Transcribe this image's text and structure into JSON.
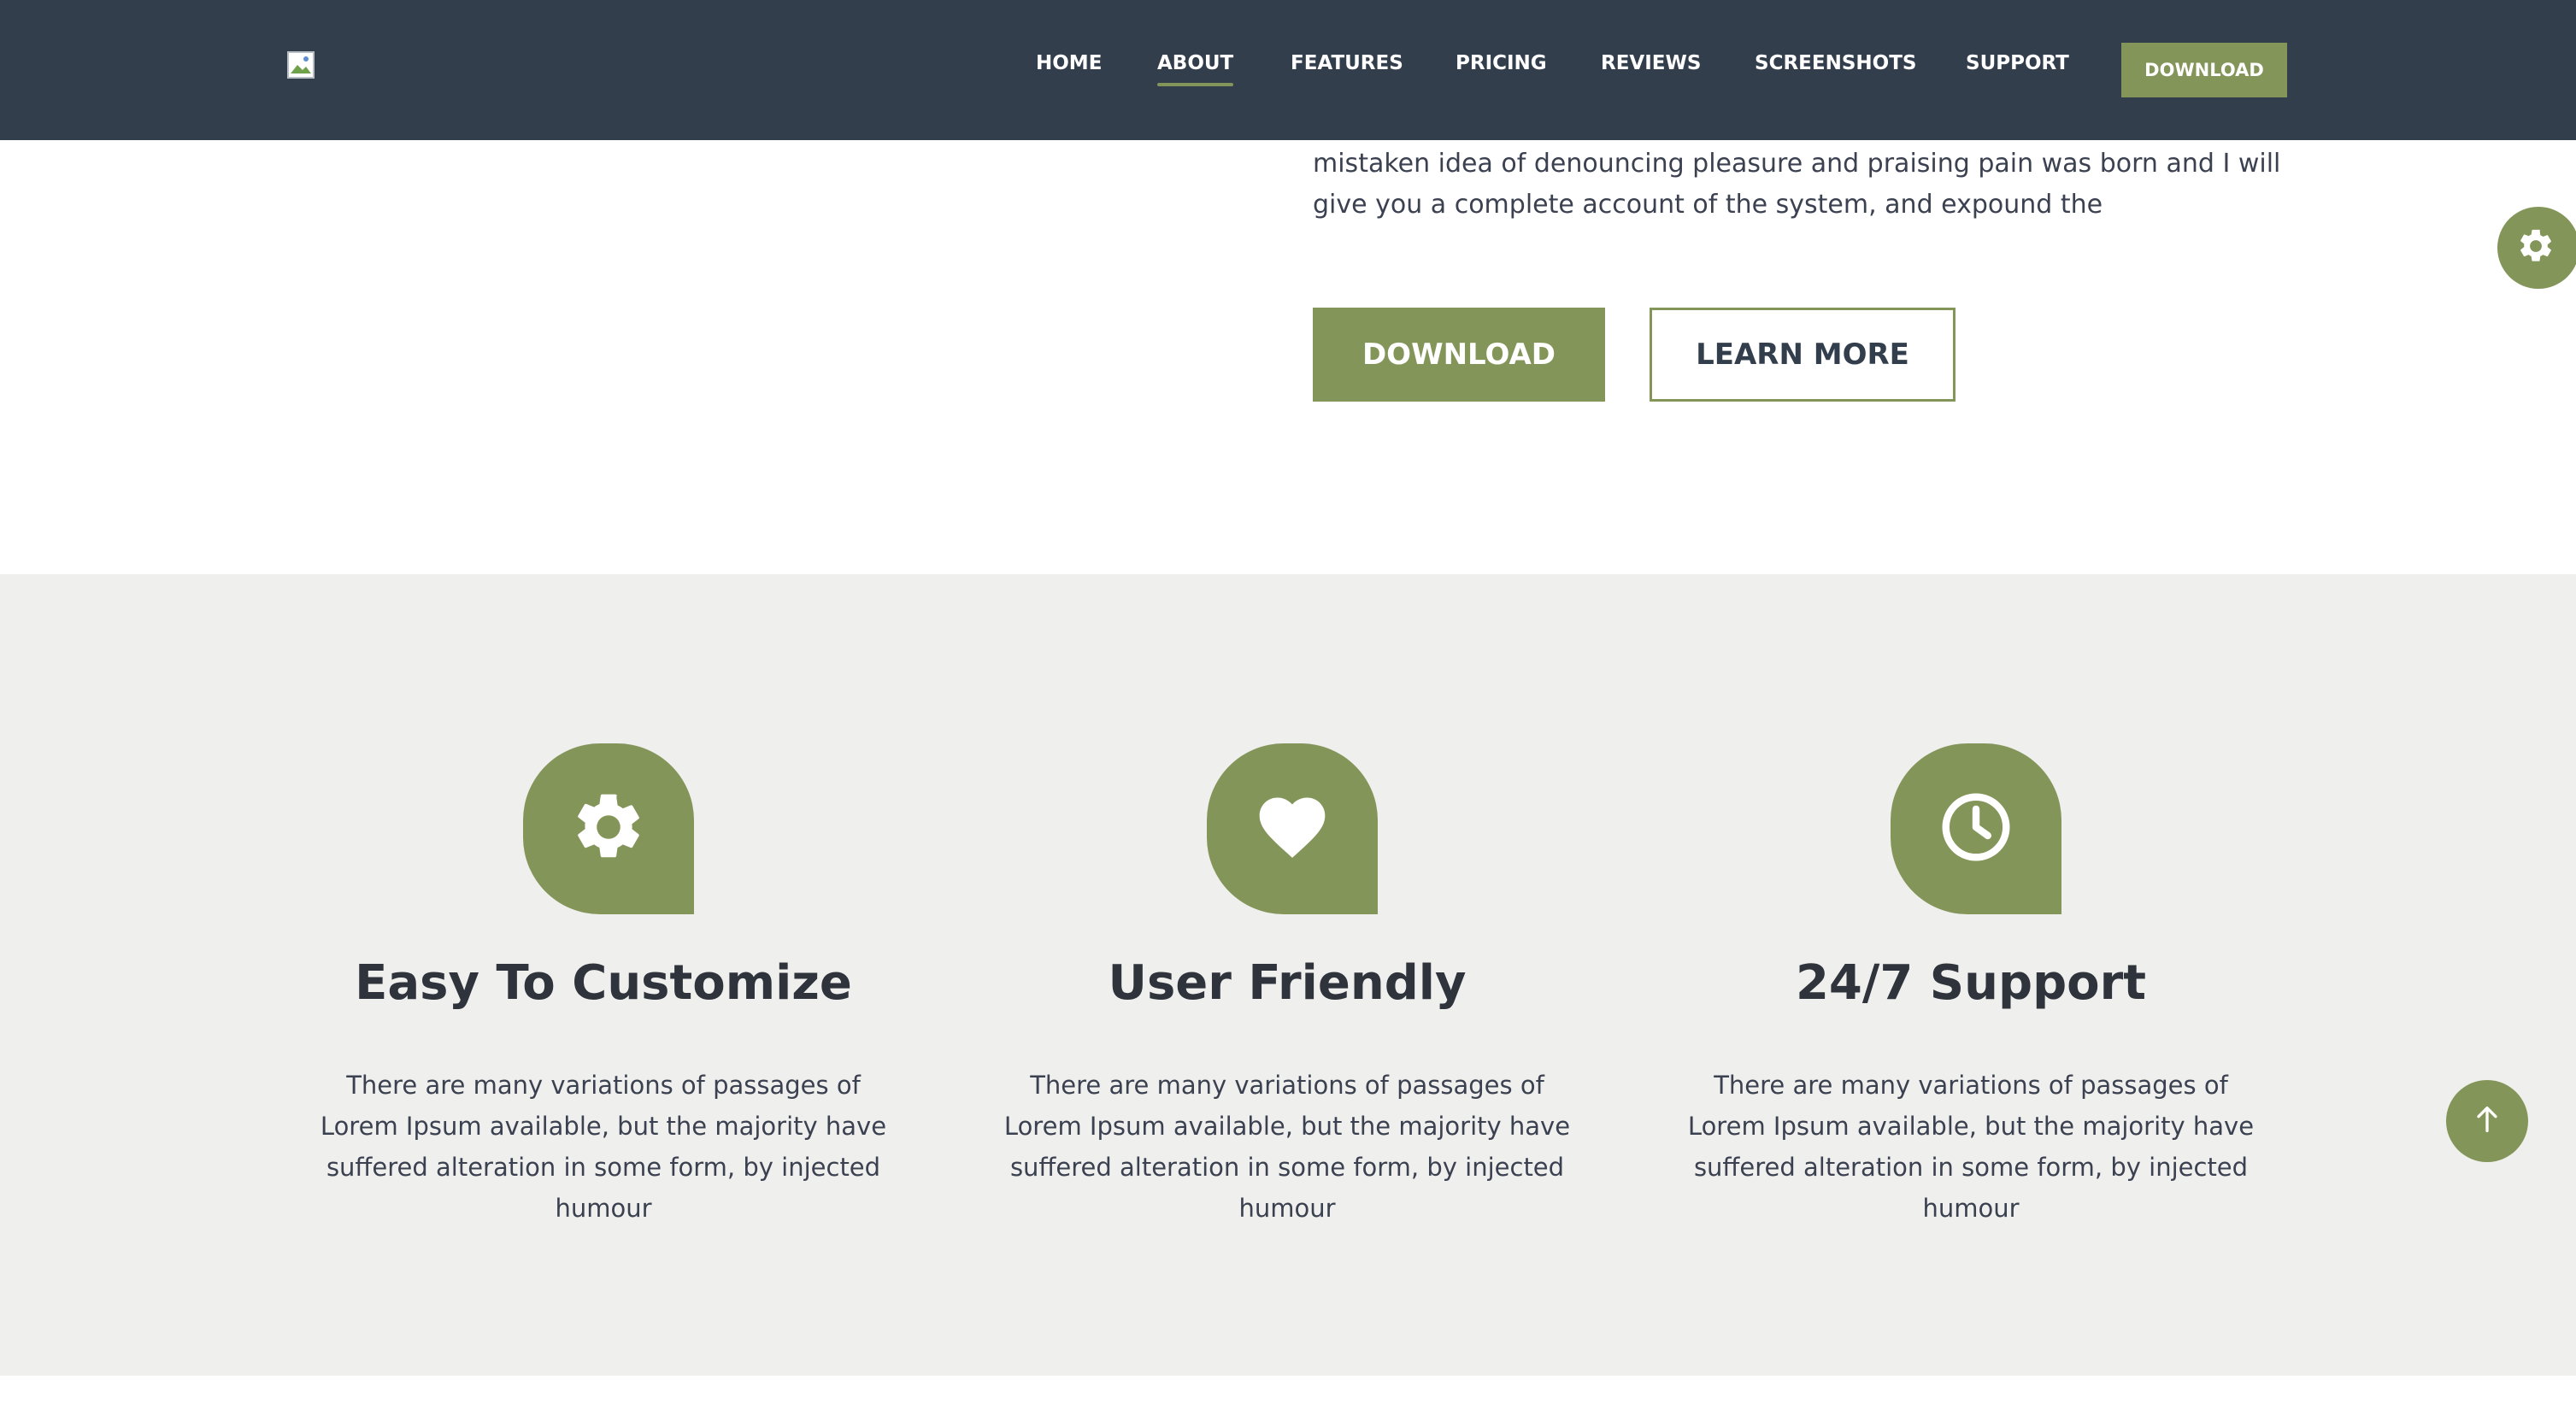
{
  "header": {
    "logo_alt": "",
    "nav": [
      {
        "label": "HOME",
        "active": false
      },
      {
        "label": "ABOUT",
        "active": true
      },
      {
        "label": "FEATURES",
        "active": false
      },
      {
        "label": "PRICING",
        "active": false
      },
      {
        "label": "REVIEWS",
        "active": false
      },
      {
        "label": "SCREENSHOTS",
        "active": false
      },
      {
        "label": "SUPPORT",
        "active": false
      }
    ],
    "download_label": "DOWNLOAD"
  },
  "hero": {
    "text": "mistaken idea of denouncing pleasure and praising pain was born and I will give you a complete account of the system, and expound the",
    "primary_button": "DOWNLOAD",
    "secondary_button": "LEARN MORE"
  },
  "features": [
    {
      "icon": "gear-icon",
      "title": "Easy To Customize",
      "description": "There are many variations of passages of Lorem Ipsum available, but the majority have suffered alteration in some form, by injected humour"
    },
    {
      "icon": "heart-icon",
      "title": "User Friendly",
      "description": "There are many variations of passages of Lorem Ipsum available, but the majority have suffered alteration in some form, by injected humour"
    },
    {
      "icon": "clock-icon",
      "title": "24/7 Support",
      "description": "There are many variations of passages of Lorem Ipsum available, but the majority have suffered alteration in some form, by injected humour"
    }
  ],
  "floating": {
    "settings_icon": "gear-icon",
    "scroll_top_icon": "arrow-up-icon"
  },
  "colors": {
    "header_bg": "#333e4d",
    "accent": "#84955a",
    "features_bg": "#efefed",
    "text": "#3b4150"
  }
}
